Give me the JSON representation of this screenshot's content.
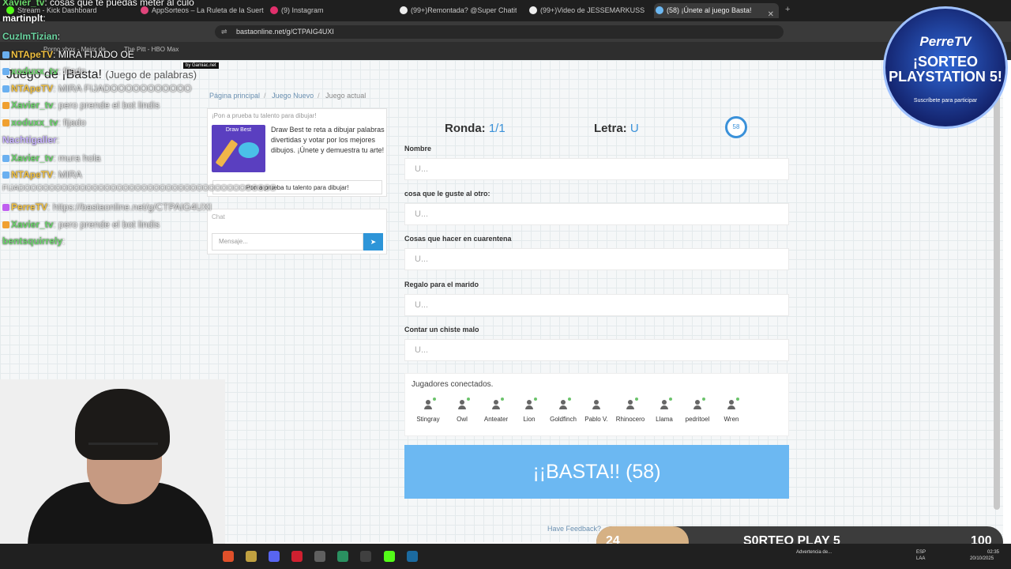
{
  "browser": {
    "tabs": [
      {
        "label": "Stream - Kick Dashboard",
        "color": "#53fc18"
      },
      {
        "label": "AppSorteos – La Ruleta de la Suerte",
        "color": "#e0457b"
      },
      {
        "label": "(9) Instagram",
        "color": "#e1306c"
      },
      {
        "label": "(99+)Remontada? @Super Chatitos",
        "color": "#ffffff"
      },
      {
        "label": "(99+)Video de JESSEMARKUSS (@",
        "color": "#ffffff"
      },
      {
        "label": "(58) ¡Únete al juego Basta!",
        "color": "#6cb8f2"
      }
    ],
    "url": "bastaonline.net/g/CTPAIG4UXI",
    "bookmarks": [
      "Porno.xbox - Mejor de",
      "The Pitt - HBO Max"
    ]
  },
  "page": {
    "site_title": "Juego de ¡Basta!",
    "site_subtitle": "(Juego de palabras)",
    "by_badge": "by Gamiac.net",
    "breadcrumb": [
      "Página principal",
      "Juego Nuevo",
      "Juego actual"
    ],
    "ad": {
      "title": "¡Pon a prueba tu talento para dibujar!",
      "image_label": "Draw Best",
      "text": "Draw Best te reta a dibujar palabras divertidas y votar por los mejores dibujos. ¡Únete y demuestra tu arte!",
      "button": "Pon a prueba tu talento para dibujar!"
    },
    "chat": {
      "label": "Chat",
      "placeholder": "Mensaje..."
    },
    "round_label": "Ronda:",
    "round_value": "1/1",
    "letter_label": "Letra:",
    "letter_value": "U",
    "timer": "58",
    "fields": [
      {
        "label": "Nombre",
        "placeholder": "U..."
      },
      {
        "label": "cosa que le guste al otro:",
        "placeholder": "U..."
      },
      {
        "label": "Cosas que hacer en cuarentena",
        "placeholder": "U..."
      },
      {
        "label": "Regalo para el marido",
        "placeholder": "U..."
      },
      {
        "label": "Contar un chiste malo",
        "placeholder": "U..."
      }
    ],
    "players_title": "Jugadores conectados.",
    "players": [
      "Stingray",
      "Owl",
      "Anteater",
      "Lion",
      "Goldfinch",
      "Pablo V.",
      "Rhinocero",
      "Llama",
      "pedritoel",
      "Wren"
    ],
    "basta_button": "¡¡BASTA!! (58)",
    "feedback": "Have Feedback?"
  },
  "stream_chat": [
    {
      "name": "Xavier_tv",
      "msg": ": cosas que te puedas meter al culo",
      "color": "#6ad46a"
    },
    {
      "name": "martinplt",
      "msg": ":",
      "color": "#ffffff"
    },
    {
      "name": "CuzImTizian",
      "msg": ":",
      "color": "#6ad4a0"
    },
    {
      "name": "NTApeTV",
      "msg": ": MIRA FIJADO OE",
      "color": "#f0c040"
    },
    {
      "name": "xoduxx_tv",
      "msg": ": fijado",
      "color": "#6ad46a"
    },
    {
      "name": "NTApeTV",
      "msg": ": MIRA FIJADOOOOOOOOOOO",
      "color": "#f0c040"
    },
    {
      "name": "Xavier_tv",
      "msg": ": pero prende el bot lindis",
      "color": "#6ad46a"
    },
    {
      "name": "xoduxx_tv",
      "msg": ": fijado",
      "color": "#6ad46a"
    },
    {
      "name": "Nachtigaller",
      "msg": ":",
      "color": "#c8b4ff"
    },
    {
      "name": "Xavier_tv",
      "msg": ": mura hola",
      "color": "#6ad46a"
    },
    {
      "name": "NTApeTV",
      "msg": ": MIRA",
      "color": "#f0c040"
    },
    {
      "name": "",
      "msg": "FIJADOOOOOOOOOOOOOOOOOOOOOOOOOOOOOOOOOOOOOOOOO",
      "color": "#ffffff"
    },
    {
      "name": "PerreTV",
      "msg": ": https://bastaonline.net/g/CTPAIG4UXI",
      "color": "#f0c040"
    },
    {
      "name": "Xavier_tv",
      "msg": ": pero prende el bot lindis",
      "color": "#6ad46a"
    },
    {
      "name": "bentsquirrely",
      "msg": ":",
      "color": "#6ad46a"
    }
  ],
  "sponsor": {
    "brand": "PerreTV",
    "headline": "¡SORTEO PLAYSTATION 5!",
    "cta": "Suscríbete para participar"
  },
  "goal": {
    "current": "24",
    "label": "S0RTEO PLAY 5",
    "max": "100",
    "progress": 0.24
  },
  "taskbar": {
    "lang": "ESP",
    "lang2": "LAA",
    "time": "02:35",
    "date": "20/10/2025",
    "notice": "Advertencia de..."
  }
}
